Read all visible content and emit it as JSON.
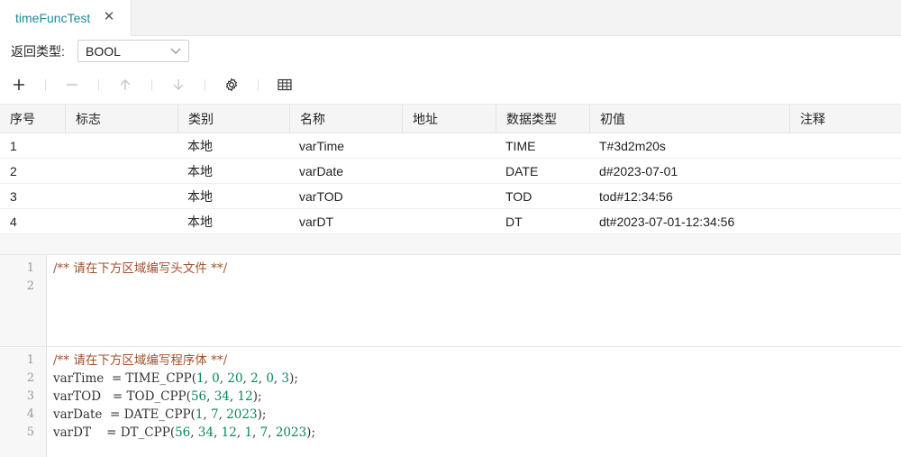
{
  "tab": {
    "title": "timeFuncTest",
    "close_icon": "close-icon"
  },
  "return_type": {
    "label": "返回类型:",
    "value": "BOOL"
  },
  "toolbar": {
    "icons": [
      "plus-icon",
      "minus-icon",
      "arrow-up-icon",
      "arrow-down-icon",
      "gear-icon",
      "table-icon"
    ]
  },
  "table": {
    "headers": [
      "序号",
      "标志",
      "类别",
      "名称",
      "地址",
      "数据类型",
      "初值",
      "注释"
    ],
    "rows": [
      [
        "1",
        "",
        "本地",
        "varTime",
        "",
        "TIME",
        "T#3d2m20s",
        ""
      ],
      [
        "2",
        "",
        "本地",
        "varDate",
        "",
        "DATE",
        "d#2023-07-01",
        ""
      ],
      [
        "3",
        "",
        "本地",
        "varTOD",
        "",
        "TOD",
        "tod#12:34:56",
        ""
      ],
      [
        "4",
        "",
        "本地",
        "varDT",
        "",
        "DT",
        "dt#2023-07-01-12:34:56",
        ""
      ]
    ]
  },
  "header_editor": {
    "line_numbers": [
      "1",
      "2"
    ],
    "lines": [
      "/** 请在下方区域编写头文件 **/",
      ""
    ]
  },
  "body_editor": {
    "line_numbers": [
      "1",
      "2",
      "3",
      "4",
      "5"
    ],
    "lines": [
      "/** 请在下方区域编写程序体 **/",
      "varTime  = TIME_CPP(1, 0, 20, 2, 0, 3);",
      "varTOD   = TOD_CPP(56, 34, 12);",
      "varDate  = DATE_CPP(1, 7, 2023);",
      "varDT    = DT_CPP(56, 34, 12, 1, 7, 2023);"
    ]
  },
  "colors": {
    "accent": "#1f8a9a",
    "comment": "#a0522d",
    "number": "#098658"
  }
}
